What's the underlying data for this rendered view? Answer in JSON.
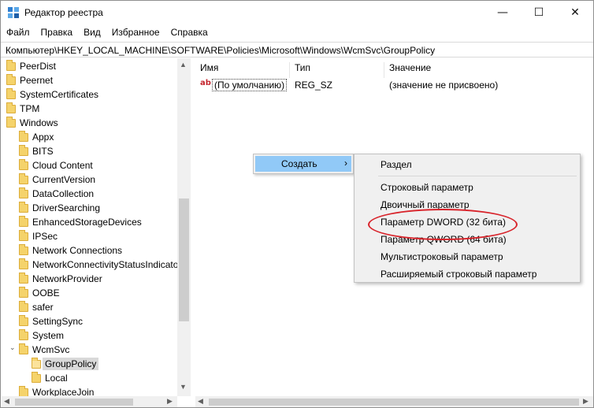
{
  "window": {
    "title": "Редактор реестра",
    "minimize": "—",
    "maximize": "☐",
    "close": "✕"
  },
  "menu": [
    "Файл",
    "Правка",
    "Вид",
    "Избранное",
    "Справка"
  ],
  "address": "Компьютер\\HKEY_LOCAL_MACHINE\\SOFTWARE\\Policies\\Microsoft\\Windows\\WcmSvc\\GroupPolicy",
  "tree": {
    "items": [
      {
        "label": "PeerDist",
        "level": 0
      },
      {
        "label": "Peernet",
        "level": 0
      },
      {
        "label": "SystemCertificates",
        "level": 0
      },
      {
        "label": "TPM",
        "level": 0
      },
      {
        "label": "Windows",
        "level": 0
      },
      {
        "label": "Appx",
        "level": 1
      },
      {
        "label": "BITS",
        "level": 1
      },
      {
        "label": "Cloud Content",
        "level": 1
      },
      {
        "label": "CurrentVersion",
        "level": 1
      },
      {
        "label": "DataCollection",
        "level": 1
      },
      {
        "label": "DriverSearching",
        "level": 1
      },
      {
        "label": "EnhancedStorageDevices",
        "level": 1
      },
      {
        "label": "IPSec",
        "level": 1
      },
      {
        "label": "Network Connections",
        "level": 1
      },
      {
        "label": "NetworkConnectivityStatusIndicator",
        "level": 1
      },
      {
        "label": "NetworkProvider",
        "level": 1
      },
      {
        "label": "OOBE",
        "level": 1
      },
      {
        "label": "safer",
        "level": 1
      },
      {
        "label": "SettingSync",
        "level": 1
      },
      {
        "label": "System",
        "level": 1
      },
      {
        "label": "WcmSvc",
        "level": 1,
        "expanded": true
      },
      {
        "label": "GroupPolicy",
        "level": 2,
        "selected": true
      },
      {
        "label": "Local",
        "level": 2
      },
      {
        "label": "WorkplaceJoin",
        "level": 1
      }
    ]
  },
  "list": {
    "columns": [
      "Имя",
      "Тип",
      "Значение"
    ],
    "rows": [
      {
        "icon": "ab",
        "name": "(По умолчанию)",
        "type": "REG_SZ",
        "value": "(значение не присвоено)"
      }
    ]
  },
  "context_menu": {
    "create_label": "Создать",
    "submenu": {
      "group1": [
        "Раздел"
      ],
      "group2": [
        "Строковый параметр",
        "Двоичный параметр",
        "Параметр DWORD (32 бита)",
        "Параметр QWORD (64 бита)",
        "Мультистроковый параметр",
        "Расширяемый строковый параметр"
      ]
    }
  },
  "colors": {
    "menu_hover": "#91c9f7",
    "highlight_ring": "#d8232a",
    "folder": "#f5d36b"
  }
}
